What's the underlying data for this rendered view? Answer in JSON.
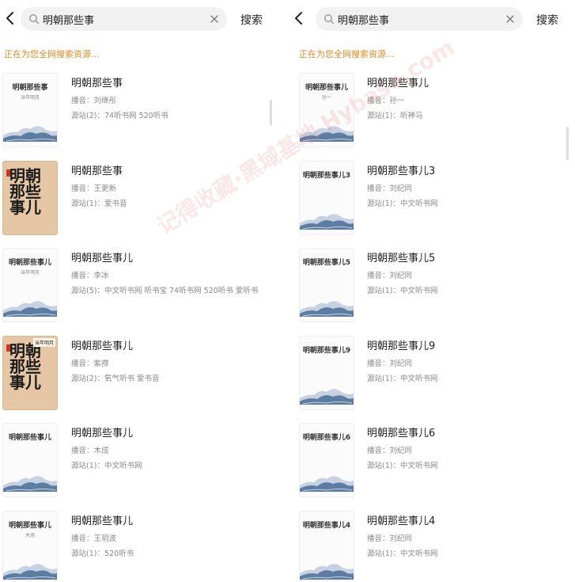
{
  "panels": [
    {
      "search_query": "明朝那些事",
      "search_label": "搜索",
      "status": "正在为您全网搜索资源...",
      "results": [
        {
          "title": "明朝那些事",
          "narrator": "播音：刘继彤",
          "sources": "源站(2)：74听书网  520听书",
          "cover_title": "明朝那些事",
          "cover_sub": "当年明月",
          "cover_style": "landscape"
        },
        {
          "title": "明朝那些事",
          "narrator": "播音：王更新",
          "sources": "源站(1)：爱书音",
          "cover_title": "明朝那些事儿",
          "cover_sub": "",
          "cover_style": "calligraphy"
        },
        {
          "title": "明朝那些事儿",
          "narrator": "播音：李冰",
          "sources": "源站(5)：中文听书网  听书宝  74听书网  520听书  爱听书",
          "cover_title": "明朝那些事儿",
          "cover_sub": "当年明月",
          "cover_style": "landscape"
        },
        {
          "title": "明朝那些事儿",
          "narrator": "播音：紫襟",
          "sources": "源站(2)：氧气听书  爱书音",
          "cover_title": "明朝那些事儿",
          "cover_sub": "",
          "cover_style": "calligraphy"
        },
        {
          "title": "明朝那些事儿",
          "narrator": "播音：木成",
          "sources": "源站(1)：中文听书网",
          "cover_title": "明朝那些事儿",
          "cover_sub": "",
          "cover_style": "landscape"
        },
        {
          "title": "明朝那些事儿",
          "narrator": "播音：王玥波",
          "sources": "源站(1)：520听书",
          "cover_title": "明朝那些事儿",
          "cover_sub": "木旭",
          "cover_style": "landscape"
        }
      ]
    },
    {
      "search_query": "明朝那些事",
      "search_label": "搜索",
      "status": "正在为您全网搜索资源...",
      "results": [
        {
          "title": "明朝那些事儿",
          "narrator": "播音：孙一",
          "sources": "源站(1)：听神马",
          "cover_title": "明朝那些事儿",
          "cover_sub": "孙一",
          "cover_style": "landscape"
        },
        {
          "title": "明朝那些事儿3",
          "narrator": "播音：刘纪同",
          "sources": "源站(1)：中文听书网",
          "cover_title": "明朝那些事儿3",
          "cover_sub": "",
          "cover_style": "landscape"
        },
        {
          "title": "明朝那些事儿5",
          "narrator": "播音：刘纪同",
          "sources": "源站(1)：中文听书网",
          "cover_title": "明朝那些事儿5",
          "cover_sub": "",
          "cover_style": "landscape"
        },
        {
          "title": "明朝那些事儿9",
          "narrator": "播音：刘纪同",
          "sources": "源站(1)：中文听书网",
          "cover_title": "明朝那些事儿9",
          "cover_sub": "",
          "cover_style": "landscape"
        },
        {
          "title": "明朝那些事儿6",
          "narrator": "播音：刘纪同",
          "sources": "源站(1)：中文听书网",
          "cover_title": "明朝那些事儿6",
          "cover_sub": "",
          "cover_style": "landscape"
        },
        {
          "title": "明朝那些事儿4",
          "narrator": "播音：刘纪同",
          "sources": "源站(1)：中文听书网",
          "cover_title": "明朝那些事儿4",
          "cover_sub": "",
          "cover_style": "landscape"
        }
      ]
    }
  ],
  "calligraphy_text": "明朝那些事儿",
  "calligraphy_tag": "当年明月",
  "watermark": "记得收藏·黑域基地 Hybase.com",
  "colors": {
    "accent": "#e08a22",
    "muted": "#888888",
    "search_bg": "#f2f2f2",
    "mountain": "#4a6d96"
  }
}
